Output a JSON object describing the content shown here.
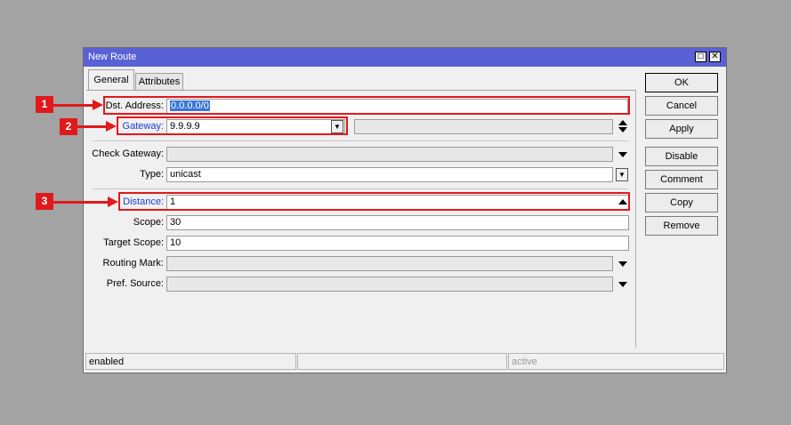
{
  "window": {
    "title": "New Route"
  },
  "tabs": [
    {
      "label": "General"
    },
    {
      "label": "Attributes"
    }
  ],
  "form": {
    "dst_address": {
      "label": "Dst. Address:",
      "value": "0.0.0.0/0"
    },
    "gateway": {
      "label": "Gateway:",
      "value": "9.9.9.9"
    },
    "check_gateway": {
      "label": "Check Gateway:",
      "value": ""
    },
    "type": {
      "label": "Type:",
      "value": "unicast"
    },
    "distance": {
      "label": "Distance:",
      "value": "1"
    },
    "scope": {
      "label": "Scope:",
      "value": "30"
    },
    "target_scope": {
      "label": "Target Scope:",
      "value": "10"
    },
    "routing_mark": {
      "label": "Routing Mark:",
      "value": ""
    },
    "pref_source": {
      "label": "Pref. Source:",
      "value": ""
    }
  },
  "buttons": {
    "ok": "OK",
    "cancel": "Cancel",
    "apply": "Apply",
    "disable": "Disable",
    "comment": "Comment",
    "copy": "Copy",
    "remove": "Remove"
  },
  "status": {
    "state": "enabled",
    "middle": "",
    "active": "active"
  },
  "annotations": {
    "marker1": "1",
    "marker2": "2",
    "marker3": "3"
  },
  "colors": {
    "title_bar": "#5a61d6",
    "annotation_red": "#e0191b",
    "link_label_blue": "#1c3fd6",
    "selection": "#3b78d8"
  }
}
